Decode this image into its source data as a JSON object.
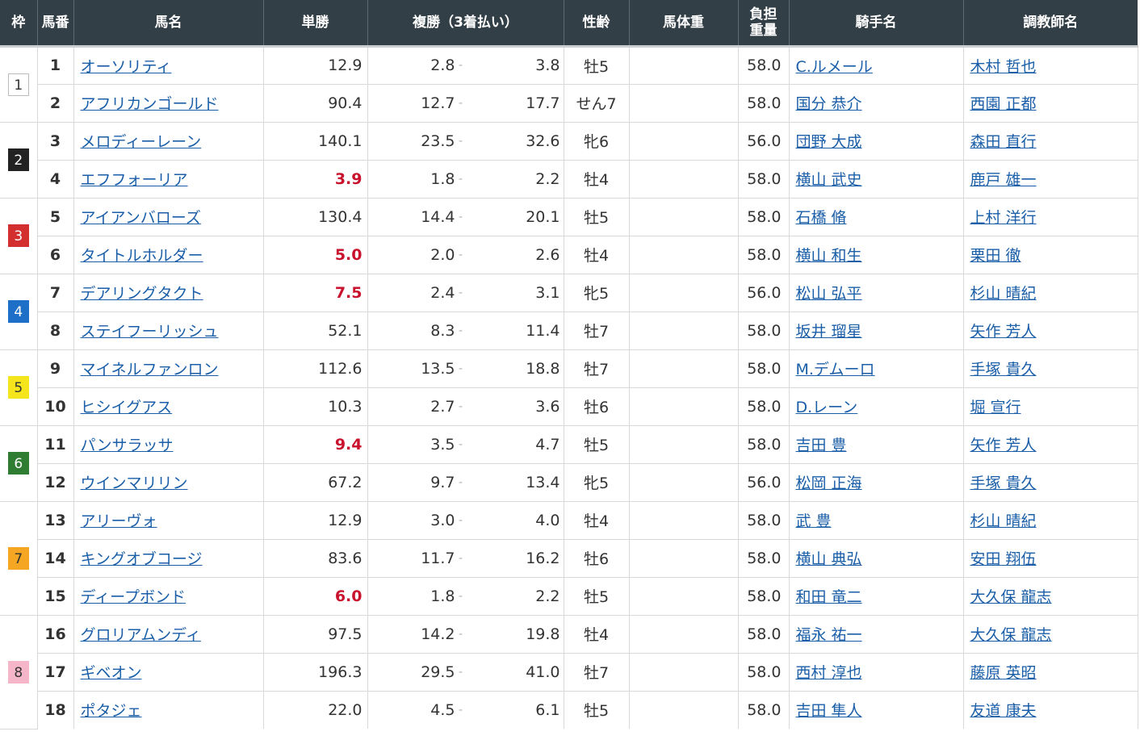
{
  "header": {
    "waku": "枠",
    "umaban": "馬番",
    "name": "馬名",
    "win": "単勝",
    "place": "複勝（3着払い）",
    "sex_age": "性齢",
    "body_weight": "馬体重",
    "kinryo_line1": "負担",
    "kinryo_line2": "重量",
    "jockey": "騎手名",
    "trainer": "調教師名"
  },
  "waku_colors": {
    "1": {
      "bg": "#ffffff",
      "fg": "#333333"
    },
    "2": {
      "bg": "#222222",
      "fg": "#ffffff"
    },
    "3": {
      "bg": "#d32f2f",
      "fg": "#ffffff"
    },
    "4": {
      "bg": "#1e6fc8",
      "fg": "#ffffff"
    },
    "5": {
      "bg": "#f5e51c",
      "fg": "#333333"
    },
    "6": {
      "bg": "#2e7d32",
      "fg": "#ffffff"
    },
    "7": {
      "bg": "#f5a623",
      "fg": "#333333"
    },
    "8": {
      "bg": "#f4b6c8",
      "fg": "#333333"
    }
  },
  "waku_groups": [
    {
      "waku": "1",
      "rows": 2
    },
    {
      "waku": "2",
      "rows": 2
    },
    {
      "waku": "3",
      "rows": 2
    },
    {
      "waku": "4",
      "rows": 2
    },
    {
      "waku": "5",
      "rows": 2
    },
    {
      "waku": "6",
      "rows": 2
    },
    {
      "waku": "7",
      "rows": 3
    },
    {
      "waku": "8",
      "rows": 3
    }
  ],
  "horses": [
    {
      "umaban": "1",
      "name": "オーソリティ",
      "win": "12.9",
      "fav": false,
      "plc_lo": "2.8",
      "plc_hi": "3.8",
      "sex_age": "牡5",
      "body_weight": "",
      "kinryo": "58.0",
      "jockey": "C.ルメール",
      "trainer": "木村 哲也"
    },
    {
      "umaban": "2",
      "name": "アフリカンゴールド",
      "win": "90.4",
      "fav": false,
      "plc_lo": "12.7",
      "plc_hi": "17.7",
      "sex_age": "せん7",
      "body_weight": "",
      "kinryo": "58.0",
      "jockey": "国分 恭介",
      "trainer": "西園 正都"
    },
    {
      "umaban": "3",
      "name": "メロディーレーン",
      "win": "140.1",
      "fav": false,
      "plc_lo": "23.5",
      "plc_hi": "32.6",
      "sex_age": "牝6",
      "body_weight": "",
      "kinryo": "56.0",
      "jockey": "団野 大成",
      "trainer": "森田 直行"
    },
    {
      "umaban": "4",
      "name": "エフフォーリア",
      "win": "3.9",
      "fav": true,
      "plc_lo": "1.8",
      "plc_hi": "2.2",
      "sex_age": "牡4",
      "body_weight": "",
      "kinryo": "58.0",
      "jockey": "横山 武史",
      "trainer": "鹿戸 雄一"
    },
    {
      "umaban": "5",
      "name": "アイアンバローズ",
      "win": "130.4",
      "fav": false,
      "plc_lo": "14.4",
      "plc_hi": "20.1",
      "sex_age": "牡5",
      "body_weight": "",
      "kinryo": "58.0",
      "jockey": "石橋 脩",
      "trainer": "上村 洋行"
    },
    {
      "umaban": "6",
      "name": "タイトルホルダー",
      "win": "5.0",
      "fav": true,
      "plc_lo": "2.0",
      "plc_hi": "2.6",
      "sex_age": "牡4",
      "body_weight": "",
      "kinryo": "58.0",
      "jockey": "横山 和生",
      "trainer": "栗田 徹"
    },
    {
      "umaban": "7",
      "name": "デアリングタクト",
      "win": "7.5",
      "fav": true,
      "plc_lo": "2.4",
      "plc_hi": "3.1",
      "sex_age": "牝5",
      "body_weight": "",
      "kinryo": "56.0",
      "jockey": "松山 弘平",
      "trainer": "杉山 晴紀"
    },
    {
      "umaban": "8",
      "name": "ステイフーリッシュ",
      "win": "52.1",
      "fav": false,
      "plc_lo": "8.3",
      "plc_hi": "11.4",
      "sex_age": "牡7",
      "body_weight": "",
      "kinryo": "58.0",
      "jockey": "坂井 瑠星",
      "trainer": "矢作 芳人"
    },
    {
      "umaban": "9",
      "name": "マイネルファンロン",
      "win": "112.6",
      "fav": false,
      "plc_lo": "13.5",
      "plc_hi": "18.8",
      "sex_age": "牡7",
      "body_weight": "",
      "kinryo": "58.0",
      "jockey": "M.デムーロ",
      "trainer": "手塚 貴久"
    },
    {
      "umaban": "10",
      "name": "ヒシイグアス",
      "win": "10.3",
      "fav": false,
      "plc_lo": "2.7",
      "plc_hi": "3.6",
      "sex_age": "牡6",
      "body_weight": "",
      "kinryo": "58.0",
      "jockey": "D.レーン",
      "trainer": "堀 宣行"
    },
    {
      "umaban": "11",
      "name": "パンサラッサ",
      "win": "9.4",
      "fav": true,
      "plc_lo": "3.5",
      "plc_hi": "4.7",
      "sex_age": "牡5",
      "body_weight": "",
      "kinryo": "58.0",
      "jockey": "吉田 豊",
      "trainer": "矢作 芳人"
    },
    {
      "umaban": "12",
      "name": "ウインマリリン",
      "win": "67.2",
      "fav": false,
      "plc_lo": "9.7",
      "plc_hi": "13.4",
      "sex_age": "牝5",
      "body_weight": "",
      "kinryo": "56.0",
      "jockey": "松岡 正海",
      "trainer": "手塚 貴久"
    },
    {
      "umaban": "13",
      "name": "アリーヴォ",
      "win": "12.9",
      "fav": false,
      "plc_lo": "3.0",
      "plc_hi": "4.0",
      "sex_age": "牡4",
      "body_weight": "",
      "kinryo": "58.0",
      "jockey": "武 豊",
      "trainer": "杉山 晴紀"
    },
    {
      "umaban": "14",
      "name": "キングオブコージ",
      "win": "83.6",
      "fav": false,
      "plc_lo": "11.7",
      "plc_hi": "16.2",
      "sex_age": "牡6",
      "body_weight": "",
      "kinryo": "58.0",
      "jockey": "横山 典弘",
      "trainer": "安田 翔伍"
    },
    {
      "umaban": "15",
      "name": "ディープボンド",
      "win": "6.0",
      "fav": true,
      "plc_lo": "1.8",
      "plc_hi": "2.2",
      "sex_age": "牡5",
      "body_weight": "",
      "kinryo": "58.0",
      "jockey": "和田 竜二",
      "trainer": "大久保 龍志"
    },
    {
      "umaban": "16",
      "name": "グロリアムンディ",
      "win": "97.5",
      "fav": false,
      "plc_lo": "14.2",
      "plc_hi": "19.8",
      "sex_age": "牡4",
      "body_weight": "",
      "kinryo": "58.0",
      "jockey": "福永 祐一",
      "trainer": "大久保 龍志"
    },
    {
      "umaban": "17",
      "name": "ギベオン",
      "win": "196.3",
      "fav": false,
      "plc_lo": "29.5",
      "plc_hi": "41.0",
      "sex_age": "牡7",
      "body_weight": "",
      "kinryo": "58.0",
      "jockey": "西村 淳也",
      "trainer": "藤原 英昭"
    },
    {
      "umaban": "18",
      "name": "ポタジェ",
      "win": "22.0",
      "fav": false,
      "plc_lo": "4.5",
      "plc_hi": "6.1",
      "sex_age": "牡5",
      "body_weight": "",
      "kinryo": "58.0",
      "jockey": "吉田 隼人",
      "trainer": "友道 康夫"
    }
  ]
}
